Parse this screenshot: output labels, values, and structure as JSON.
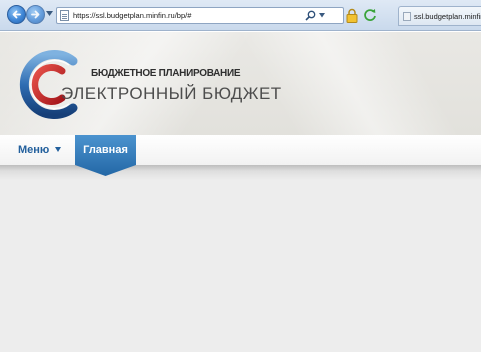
{
  "browser": {
    "url": "https://ssl.budgetplan.minfin.ru/bp/#",
    "tab_title": "ssl.budgetplan.minfin.r",
    "icons": [
      "back-arrow-icon",
      "forward-arrow-icon",
      "page-icon",
      "search-icon",
      "lock-icon",
      "refresh-icon"
    ]
  },
  "site": {
    "brand_subtitle": "БЮДЖЕТНОЕ ПЛАНИРОВАНИЕ",
    "brand_title": "ЭЛЕКТРОННЫЙ БЮДЖЕТ"
  },
  "menu": {
    "menu_label": "Меню",
    "home_label": "Главная",
    "accent_color": "#2f78b6",
    "link_color": "#23609d"
  }
}
